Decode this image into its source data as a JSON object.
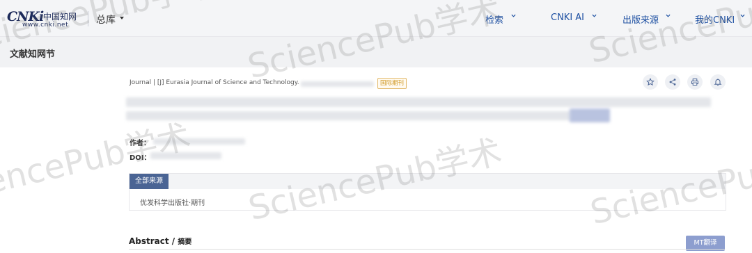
{
  "header": {
    "logo_text": "CNKi",
    "logo_cn": "中国知网",
    "logo_url": "www.cnki.net",
    "library_select": "总库",
    "nav": [
      {
        "label": "检索"
      },
      {
        "label": "CNKI AI"
      },
      {
        "label": "出版来源"
      },
      {
        "label": "我的CNKI"
      }
    ]
  },
  "page_title": "文献知网节",
  "article": {
    "journal_line": "Journal | [J] Eurasia Journal of Science and Technology.",
    "intl_badge": "国际期刊",
    "authors_label": "作者：",
    "doi_label": "DOI："
  },
  "source": {
    "tab_label": "全部来源",
    "item": "优发科学出版社·期刊"
  },
  "abstract": {
    "title": "Abstract",
    "separator": " / ",
    "title_cn": "摘要",
    "mt_button": "MT翻译"
  },
  "watermark": "SciencePub学术"
}
